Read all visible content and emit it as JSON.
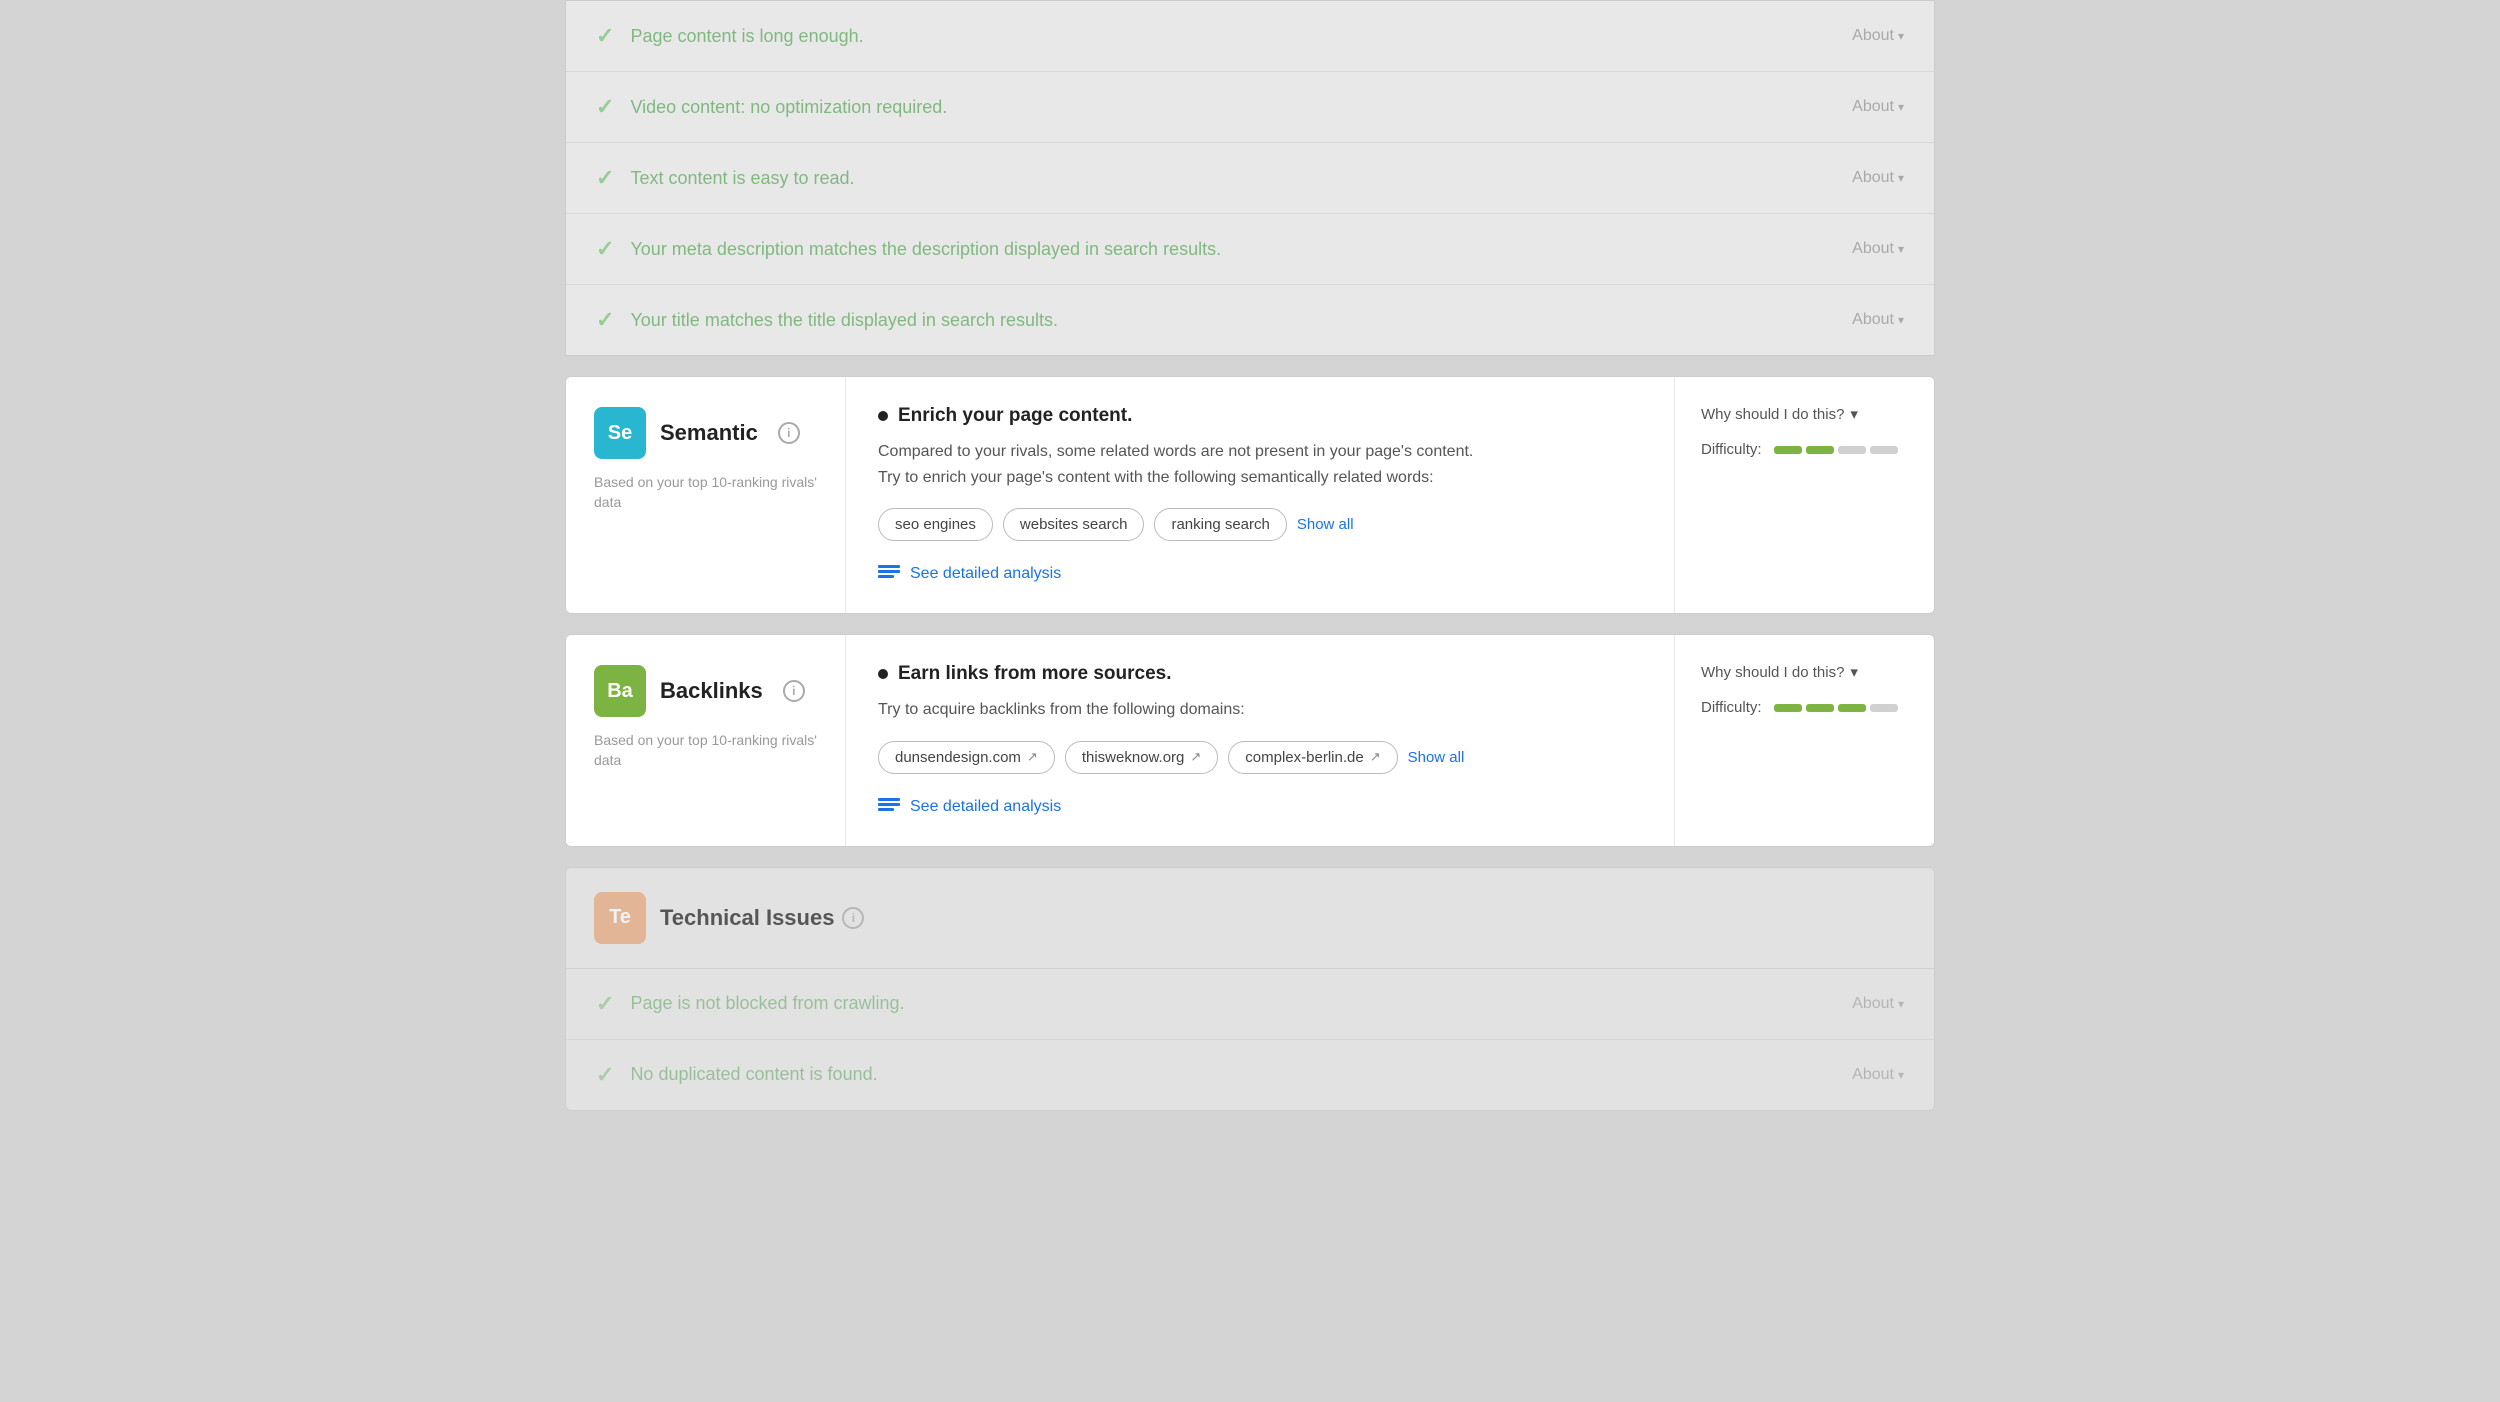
{
  "topRows": [
    {
      "text": "Page content is long enough.",
      "about": "About"
    },
    {
      "text": "Video content: no optimization required.",
      "about": "About"
    },
    {
      "text": "Text content is easy to read.",
      "about": "About"
    },
    {
      "text": "Your meta description matches the description displayed in search results.",
      "about": "About"
    },
    {
      "text": "Your title matches the title displayed in search results.",
      "about": "About"
    }
  ],
  "semantic": {
    "iconText": "Se",
    "iconClass": "icon-box-blue",
    "title": "Semantic",
    "subtitle": "Based on your top 10-ranking rivals' data",
    "mainTitle": "Enrich your page content.",
    "desc1": "Compared to your rivals, some related words are not present in your page's content.",
    "desc2": "Try to enrich your page's content with the following semantically related words:",
    "tags": [
      "seo engines",
      "websites search",
      "ranking search"
    ],
    "showAll": "Show all",
    "analysisLink": "See detailed analysis",
    "whyLabel": "Why should I do this?",
    "difficultyLabel": "Difficulty:",
    "diffBars": [
      true,
      true,
      false,
      false
    ]
  },
  "backlinks": {
    "iconText": "Ba",
    "iconClass": "icon-box-green",
    "title": "Backlinks",
    "subtitle": "Based on your top 10-ranking rivals' data",
    "mainTitle": "Earn links from more sources.",
    "desc1": "Try to acquire backlinks from the following domains:",
    "tags": [
      "dunsendesign.com",
      "thisweknow.org",
      "complex-berlin.de"
    ],
    "showAll": "Show all",
    "analysisLink": "See detailed analysis",
    "whyLabel": "Why should I do this?",
    "difficultyLabel": "Difficulty:",
    "diffBars": [
      true,
      true,
      true,
      false
    ]
  },
  "technical": {
    "iconText": "Te",
    "iconClass": "icon-box-orange",
    "title": "Technical Issues",
    "rows": [
      {
        "text": "Page is not blocked from crawling.",
        "about": "About"
      },
      {
        "text": "No duplicated content is found.",
        "about": "About"
      }
    ]
  }
}
